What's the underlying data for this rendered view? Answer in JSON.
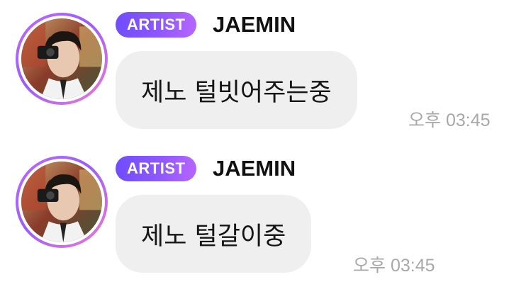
{
  "messages": [
    {
      "badge": "ARTIST",
      "sender": "JAEMIN",
      "text": "제노 털빗어주는중",
      "time": "오후 03:45",
      "avatar_icon": "profile-photo"
    },
    {
      "badge": "ARTIST",
      "sender": "JAEMIN",
      "text": "제노 털갈이중",
      "time": "오후 03:45",
      "avatar_icon": "profile-photo"
    }
  ],
  "colors": {
    "badge_start": "#6f4dff",
    "badge_end": "#b665ff",
    "bubble_bg": "#efefef",
    "time_text": "#a8a8a8"
  }
}
